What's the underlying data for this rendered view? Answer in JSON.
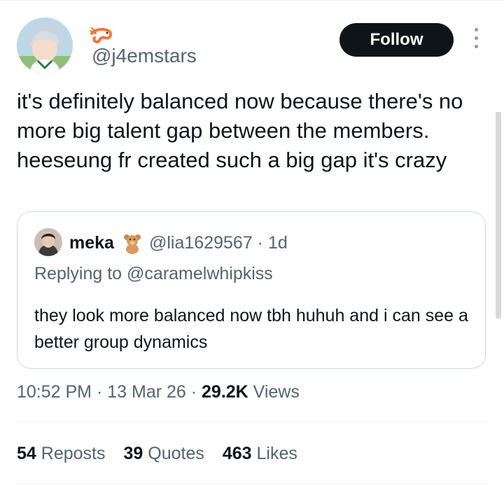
{
  "tweet": {
    "handle": "@j4emstars",
    "follow_label": "Follow",
    "text": "it's definitely balanced now because there's no more big talent gap between the members. heeseung fr created such a big gap it's crazy"
  },
  "quoted_tweet": {
    "name": "meka",
    "handle": "@lia1629567",
    "separator": " · ",
    "age": "1d",
    "replying_prefix": "Replying to ",
    "replying_to": "@caramelwhipkiss",
    "text": "they look more balanced now tbh huhuh and i can see a better group dynamics"
  },
  "meta": {
    "time": "10:52 PM",
    "separator": " · ",
    "date": "13 Mar 26",
    "views_count": "29.2K",
    "views_label": " Views"
  },
  "stats": {
    "reposts_count": "54",
    "reposts_label": " Reposts",
    "quotes_count": "39",
    "quotes_label": " Quotes",
    "likes_count": "463",
    "likes_label": " Likes"
  },
  "icons": {
    "name_emoji": "shrimp-icon",
    "quoted_name_emoji": "teddy-bear-icon",
    "more": "more-options-icon"
  },
  "colors": {
    "follow_bg": "#0f1419",
    "secondary_text": "#536471",
    "border": "#cfd9de"
  }
}
